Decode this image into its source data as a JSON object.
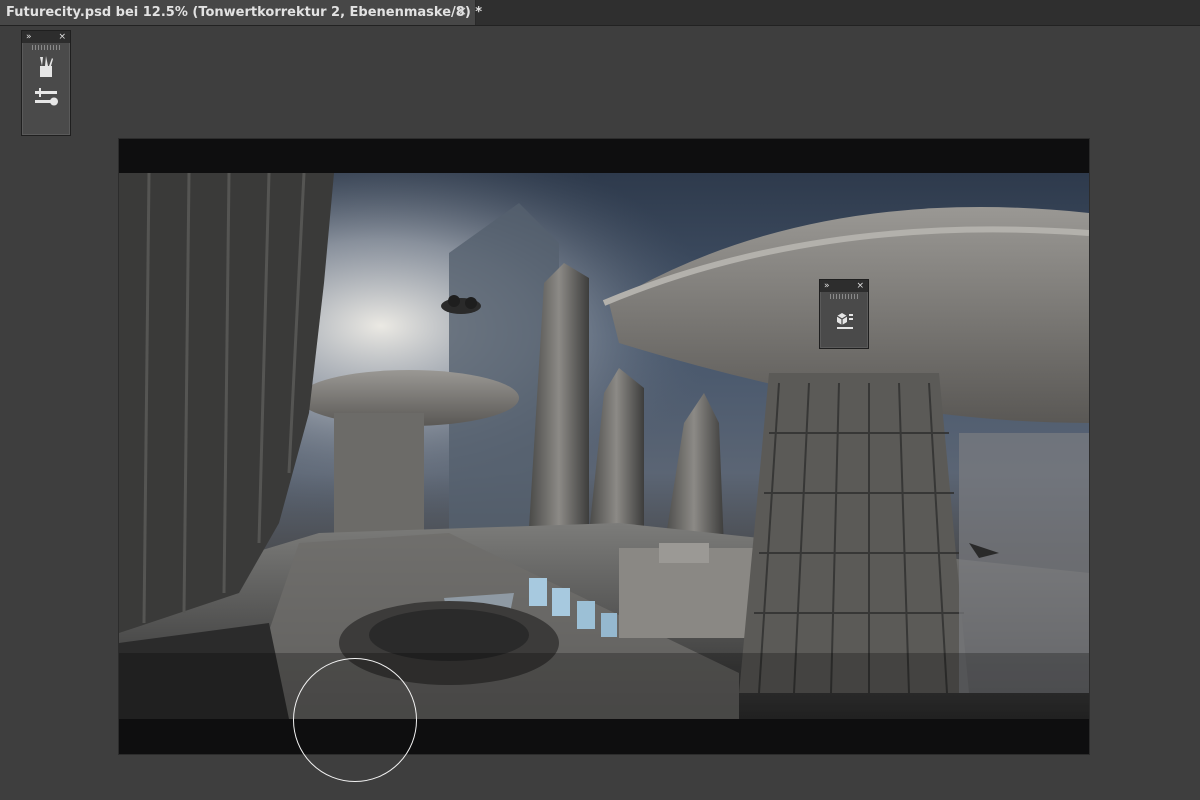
{
  "document_tab": {
    "title": "Futurecity.psd bei 12.5% (Tonwertkorrektur 2, Ebenenmaske/8) *",
    "close_glyph": "×"
  },
  "left_panel": {
    "collapse_glyph": "»",
    "close_glyph": "×",
    "tools": [
      {
        "icon": "brushes-icon"
      },
      {
        "icon": "brush-presets-icon"
      }
    ]
  },
  "mid_panel": {
    "collapse_glyph": "»",
    "close_glyph": "×",
    "tools": [
      {
        "icon": "3d-icon"
      }
    ]
  },
  "colors": {
    "workspace_bg": "#3e3e3e",
    "tabbar_bg": "#2f2f2f",
    "active_tab_bg": "#474747",
    "canvas_letterbox": "#0e0e0f",
    "cursor_outline": "#f2f2f2"
  }
}
